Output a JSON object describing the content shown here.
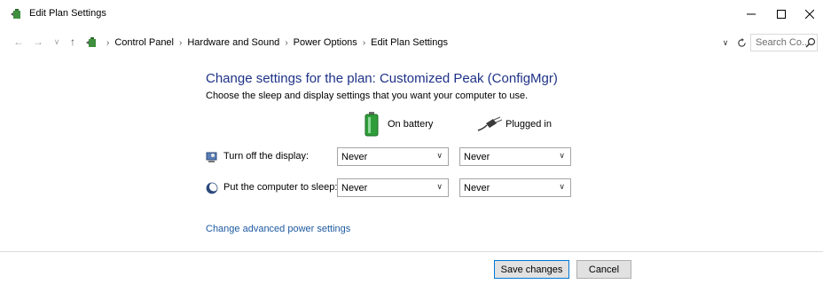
{
  "window": {
    "title": "Edit Plan Settings",
    "controls": {
      "minimize": "minimize-icon",
      "maximize": "maximize-icon",
      "close": "close-icon"
    }
  },
  "address_bar": {
    "breadcrumbs": [
      "Control Panel",
      "Hardware and Sound",
      "Power Options",
      "Edit Plan Settings"
    ],
    "search_placeholder": "Search Co..."
  },
  "content": {
    "heading": "Change settings for the plan: Customized Peak (ConfigMgr)",
    "subheading": "Choose the sleep and display settings that you want your computer to use.",
    "columns": {
      "battery": "On battery",
      "plugged": "Plugged in"
    },
    "rows": [
      {
        "label": "Turn off the display:",
        "battery_value": "Never",
        "plugged_value": "Never",
        "icon": "display-icon"
      },
      {
        "label": "Put the computer to sleep:",
        "battery_value": "Never",
        "plugged_value": "Never",
        "icon": "sleep-icon"
      }
    ],
    "advanced_link": "Change advanced power settings"
  },
  "footer": {
    "save_label": "Save changes",
    "cancel_label": "Cancel"
  },
  "colors": {
    "heading": "#1e3287",
    "link": "#1e5aa0",
    "default_button_border": "#0078d7"
  }
}
